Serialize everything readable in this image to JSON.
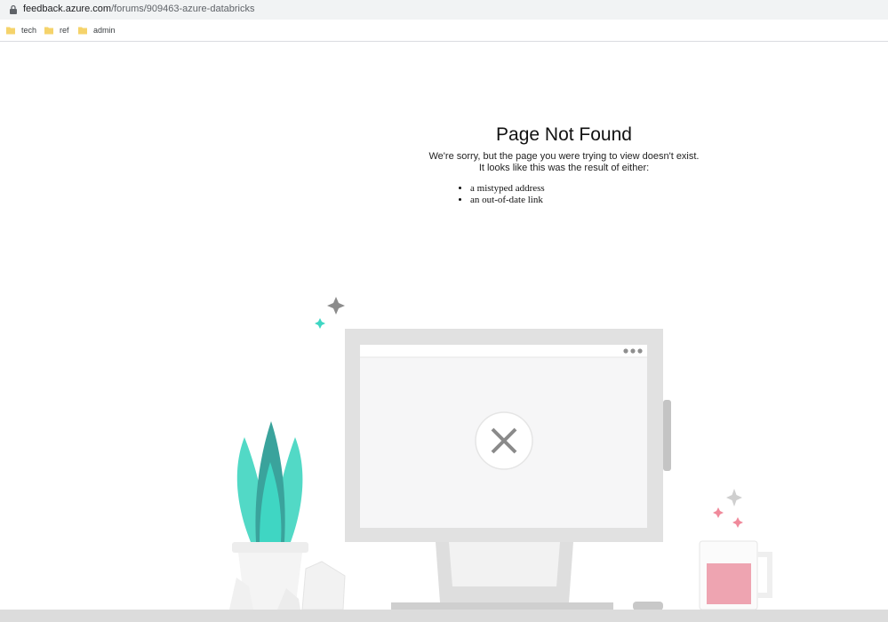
{
  "browser": {
    "url_host": "feedback.azure.com",
    "url_path": "/forums/909463-azure-databricks",
    "bookmarks": [
      {
        "label": "tech",
        "icon": "folder-icon"
      },
      {
        "label": "ref",
        "icon": "folder-icon"
      },
      {
        "label": "admin",
        "icon": "folder-icon"
      }
    ]
  },
  "page": {
    "title": "Page Not Found",
    "line1": "We're sorry, but the page you were trying to view doesn't exist.",
    "line2": "It looks like this was the result of either:",
    "reasons": [
      "a mistyped address",
      "an out-of-date link"
    ]
  },
  "colors": {
    "plant": "#3fd6c3",
    "mug": "#f0a5b4",
    "monitor": "#e1e1e1"
  }
}
